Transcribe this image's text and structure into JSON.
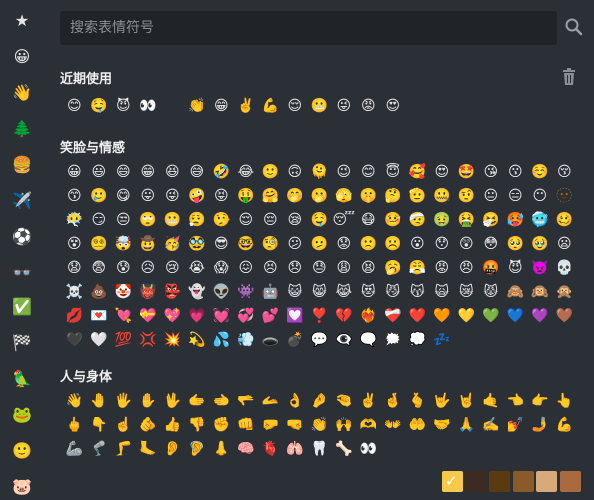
{
  "colors": {
    "background": "#2b2f36",
    "search_bg": "#202429",
    "accent": "#f5c94a"
  },
  "sidebar": {
    "items": [
      {
        "name": "sidebar-item-recent",
        "icon": "★",
        "icon_name": "star-icon"
      },
      {
        "name": "sidebar-item-smileys",
        "icon": "😀",
        "icon_name": "smiley-icon"
      },
      {
        "name": "sidebar-item-people",
        "icon": "👋",
        "icon_name": "waving-hand-icon"
      },
      {
        "name": "sidebar-item-nature",
        "icon": "🌲",
        "icon_name": "tree-icon"
      },
      {
        "name": "sidebar-item-food",
        "icon": "🍔",
        "icon_name": "burger-icon"
      },
      {
        "name": "sidebar-item-travel",
        "icon": "✈️",
        "icon_name": "airplane-icon"
      },
      {
        "name": "sidebar-item-activities",
        "icon": "⚽",
        "icon_name": "soccer-ball-icon"
      },
      {
        "name": "sidebar-item-objects",
        "icon": "👓",
        "icon_name": "glasses-icon"
      },
      {
        "name": "sidebar-item-symbols",
        "icon": "✅",
        "icon_name": "check-mark-icon"
      },
      {
        "name": "sidebar-item-flags",
        "icon": "🏁",
        "icon_name": "flag-icon"
      },
      {
        "name": "sidebar-item-custom-1",
        "icon": "🦜",
        "icon_name": "custom-emoji-icon"
      },
      {
        "name": "sidebar-item-custom-2",
        "icon": "🐸",
        "icon_name": "custom-emoji-icon"
      },
      {
        "name": "sidebar-item-custom-3",
        "icon": "🙂",
        "icon_name": "custom-emoji-icon"
      },
      {
        "name": "sidebar-item-custom-4",
        "icon": "🐷",
        "icon_name": "custom-emoji-icon"
      }
    ]
  },
  "search": {
    "placeholder": "搜索表情符号"
  },
  "sections": [
    {
      "title": "近期使用",
      "rows": [
        [
          "😊",
          "🤤",
          "😈",
          "👀",
          "",
          "👏",
          "😁",
          "✌️",
          "💪",
          "😌",
          "😬",
          "😜",
          "😡",
          "😍"
        ]
      ]
    },
    {
      "title": "笑脸与情感",
      "rows": [
        [
          "😀",
          "😃",
          "😄",
          "😁",
          "😆",
          "😅",
          "🤣",
          "😂",
          "🙂",
          "🙃",
          "🫠",
          "😉",
          "😊",
          "😇",
          "🥰",
          "😍",
          "🤩",
          "😘",
          "😗",
          "☺️",
          "😚"
        ],
        [
          "😙",
          "🥲",
          "😋",
          "😛",
          "😜",
          "🤪",
          "😝",
          "🤑",
          "🤗",
          "🤭",
          "🫢",
          "🫣",
          "🤫",
          "🤔",
          "🫡",
          "🤐",
          "🤨",
          "😐",
          "😑",
          "😶",
          "🫥"
        ],
        [
          "😶‍🌫️",
          "😏",
          "😒",
          "🙄",
          "😬",
          "😮‍💨",
          "🤥",
          "😌",
          "😔",
          "😪",
          "🤤",
          "😴",
          "😷",
          "🤒",
          "🤕",
          "🤢",
          "🤮",
          "🤧",
          "🥵",
          "🥶",
          "🥴"
        ],
        [
          "😵",
          "😵‍💫",
          "🤯",
          "🤠",
          "🥳",
          "🥸",
          "😎",
          "🤓",
          "🧐",
          "😕",
          "🫤",
          "😟",
          "🙁",
          "☹️",
          "😮",
          "😯",
          "😲",
          "😳",
          "🥺",
          "🥹",
          "😦"
        ],
        [
          "😧",
          "😨",
          "😰",
          "😥",
          "😢",
          "😭",
          "😱",
          "😖",
          "😣",
          "😞",
          "😓",
          "😩",
          "😫",
          "🥱",
          "😤",
          "😡",
          "😠",
          "🤬",
          "😈",
          "👿",
          "💀"
        ],
        [
          "☠️",
          "💩",
          "🤡",
          "👹",
          "👺",
          "👻",
          "👽",
          "👾",
          "🤖",
          "😺",
          "😸",
          "😹",
          "😻",
          "😼",
          "😽",
          "🙀",
          "😿",
          "😾",
          "🙈",
          "🙉",
          "🙊"
        ],
        [
          "💋",
          "💌",
          "💘",
          "💝",
          "💖",
          "💗",
          "💓",
          "💞",
          "💕",
          "💟",
          "❣️",
          "💔",
          "❤️‍🔥",
          "❤️‍🩹",
          "❤️",
          "🧡",
          "💛",
          "💚",
          "💙",
          "💜",
          "🤎"
        ],
        [
          "🖤",
          "🤍",
          "💯",
          "💢",
          "💥",
          "💫",
          "💦",
          "💨",
          "🕳️",
          "💣",
          "💬",
          "👁️‍🗨️",
          "🗨️",
          "🗯️",
          "💭",
          "💤"
        ]
      ]
    },
    {
      "title": "人与身体",
      "rows": [
        [
          "👋",
          "🤚",
          "🖐️",
          "✋",
          "🖖",
          "🫱",
          "🫲",
          "🫳",
          "🫴",
          "👌",
          "🤌",
          "🤏",
          "✌️",
          "🤞",
          "🫰",
          "🤟",
          "🤘",
          "🤙",
          "👈",
          "👉",
          "👆"
        ],
        [
          "🖕",
          "👇",
          "☝️",
          "🫵",
          "👍",
          "👎",
          "✊",
          "👊",
          "🤛",
          "🤜",
          "👏",
          "🙌",
          "🫶",
          "👐",
          "🤲",
          "🤝",
          "🙏",
          "✍️",
          "💅",
          "🤳",
          "💪"
        ],
        [
          "🦾",
          "🦿",
          "🦵",
          "🦶",
          "👂",
          "🦻",
          "👃",
          "🧠",
          "🫀",
          "🫁",
          "🦷",
          "🦴",
          "👀"
        ]
      ]
    }
  ],
  "skin_tones": [
    {
      "color": "#f5c94a",
      "selected": "✓"
    },
    {
      "color": "#3d2a20",
      "selected": ""
    },
    {
      "color": "#5b3a12",
      "selected": ""
    },
    {
      "color": "#8a5a2b",
      "selected": ""
    },
    {
      "color": "#d8a97a",
      "selected": ""
    },
    {
      "color": "#a86a3e",
      "selected": ""
    }
  ]
}
